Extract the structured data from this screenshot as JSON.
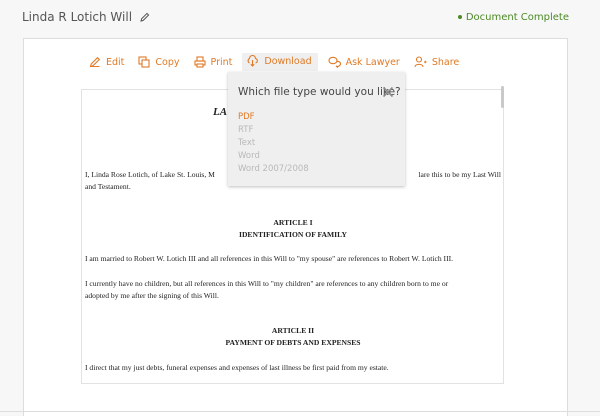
{
  "header": {
    "title": "Linda R Lotich Will",
    "status": "Document Complete"
  },
  "toolbar": {
    "edit": "Edit",
    "copy": "Copy",
    "print": "Print",
    "download": "Download",
    "ask_lawyer": "Ask Lawyer",
    "share": "Share"
  },
  "download_menu": {
    "prompt": "Which file type would you like?",
    "options": [
      {
        "label": "PDF",
        "state": "selected"
      },
      {
        "label": "RTF",
        "state": "disabled"
      },
      {
        "label": "Text",
        "state": "disabled"
      },
      {
        "label": "Word",
        "state": "disabled"
      },
      {
        "label": "Word 2007/2008",
        "state": "disabled"
      }
    ]
  },
  "document": {
    "title_fragment": "LA",
    "intro_left": "I, Linda Rose Lotich, of Lake St. Louis, M",
    "intro_right": "lare this to be my Last Will",
    "intro_line2": "and Testament.",
    "article1_title": "ARTICLE I",
    "article1_subtitle": "IDENTIFICATION OF FAMILY",
    "para1": "I am married to Robert W. Lotich III and all references in this Will to \"my spouse\" are references to Robert W. Lotich III.",
    "para2_line1": "I currently have no children, but all references in this Will to \"my children\" are references to any children born to me or",
    "para2_line2": "adopted by me after the signing of this Will.",
    "article2_title": "ARTICLE II",
    "article2_subtitle": "PAYMENT OF DEBTS AND EXPENSES",
    "para3": "I direct that my just debts, funeral expenses and expenses of last illness be first paid from my estate."
  },
  "colors": {
    "accent": "#e07a26",
    "status_green": "#4b8a24",
    "disabled": "#b9b9b9"
  }
}
